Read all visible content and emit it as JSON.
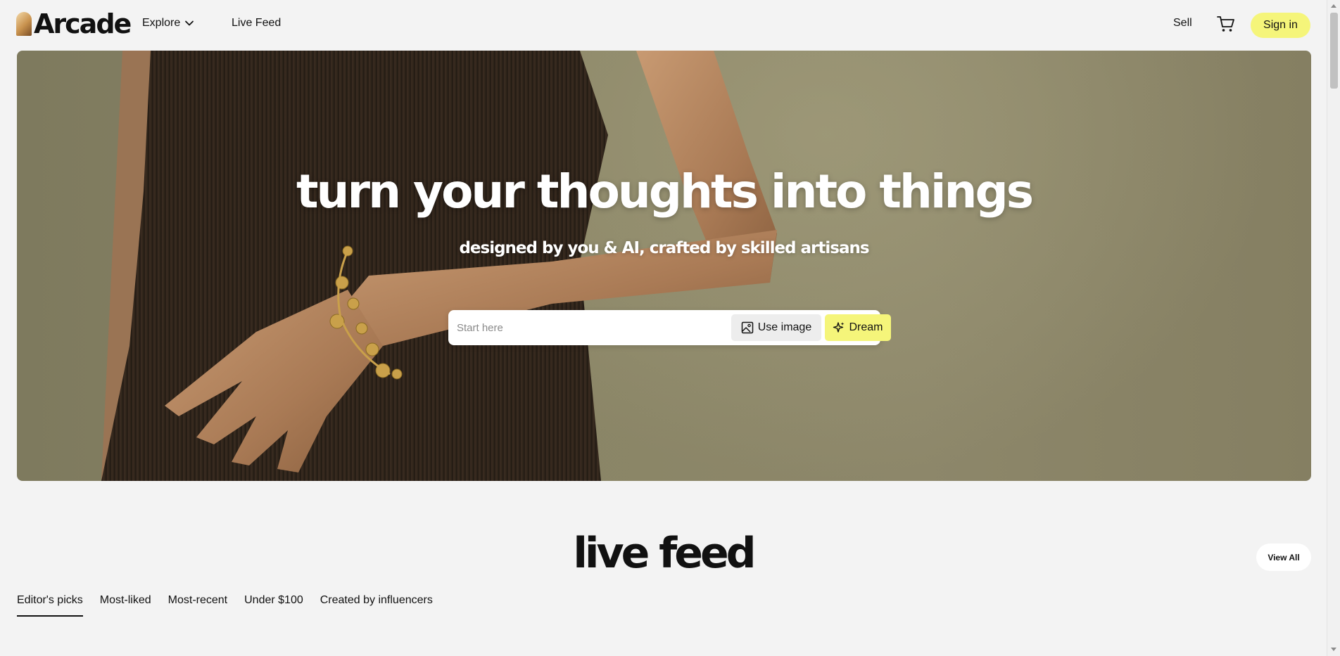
{
  "header": {
    "logo_text": "Arcade",
    "nav": {
      "explore_label": "Explore",
      "live_feed_label": "Live Feed"
    },
    "sell_label": "Sell",
    "cart_icon": "cart-icon",
    "signin_label": "Sign in"
  },
  "hero": {
    "title": "turn your thoughts into things",
    "subtitle": "designed by you & AI, crafted by skilled artisans",
    "prompt": {
      "placeholder": "Start here",
      "use_image_label": "Use image",
      "dream_label": "Dream"
    }
  },
  "live_feed": {
    "title": "live feed",
    "view_all_label": "View All",
    "tabs": [
      {
        "label": "Editor's picks",
        "active": true
      },
      {
        "label": "Most-liked",
        "active": false
      },
      {
        "label": "Most-recent",
        "active": false
      },
      {
        "label": "Under $100",
        "active": false
      },
      {
        "label": "Created by influencers",
        "active": false
      }
    ]
  },
  "colors": {
    "accent_yellow": "#f5f57a",
    "page_background": "#f3f3f3",
    "text": "#111111"
  }
}
